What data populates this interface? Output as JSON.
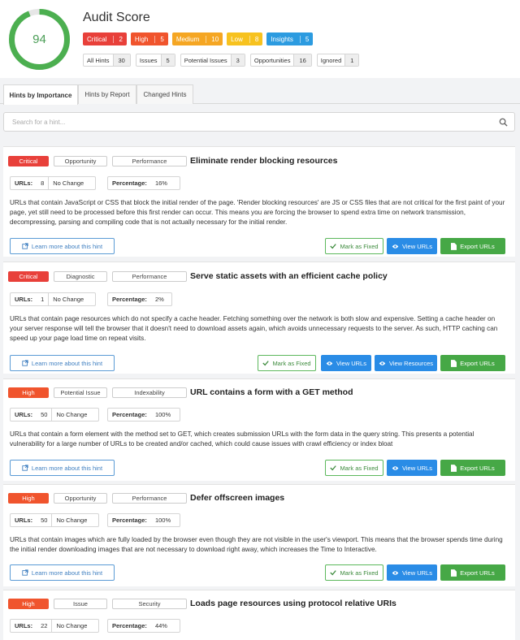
{
  "audit": {
    "title": "Audit Score",
    "score": "94",
    "score_fraction": 0.94,
    "severities": [
      {
        "label": "Critical",
        "count": "2",
        "color": "#e8403a"
      },
      {
        "label": "High",
        "count": "5",
        "color": "#f0542d"
      },
      {
        "label": "Medium",
        "count": "10",
        "color": "#f5a623"
      },
      {
        "label": "Low",
        "count": "8",
        "color": "#f7c21f"
      },
      {
        "label": "Insights",
        "count": "5",
        "color": "#2c9be0"
      }
    ],
    "counts": [
      {
        "label": "All Hints",
        "count": "30"
      },
      {
        "label": "Issues",
        "count": "5"
      },
      {
        "label": "Potential Issues",
        "count": "3"
      },
      {
        "label": "Opportunities",
        "count": "16"
      },
      {
        "label": "Ignored",
        "count": "1"
      }
    ]
  },
  "tabs": [
    "Hints by Importance",
    "Hints by Report",
    "Changed Hints"
  ],
  "search": {
    "placeholder": "Search for a hint..."
  },
  "labels": {
    "urls": "URLs:",
    "percentage": "Percentage:",
    "learn_more": "Learn more about this hint",
    "mark_fixed": "Mark as Fixed",
    "view_urls": "View URLs",
    "view_resources": "View Resources",
    "export_urls": "Export URLs"
  },
  "hints": [
    {
      "severity": "Critical",
      "severity_color": "#e8403a",
      "type": "Opportunity",
      "category": "Performance",
      "title": "Eliminate render blocking resources",
      "urls": "8",
      "change": "No Change",
      "percentage": "16%",
      "desc": "URLs that contain JavaScript or CSS that block the initial render of the page. 'Render blocking resources' are JS or CSS files that are not critical for the first paint of your page, yet still need to be processed before this first render can occur. This means you are forcing the browser to spend extra time on network transmission, decompressing, parsing and compiling code that is not actually necessary for the initial render."
    },
    {
      "severity": "Critical",
      "severity_color": "#e8403a",
      "type": "Diagnostic",
      "category": "Performance",
      "title": "Serve static assets with an efficient cache policy",
      "urls": "1",
      "change": "No Change",
      "percentage": "2%",
      "desc": "URLs that contain page resources which do not specify a cache header. Fetching something over the network is both slow and expensive. Setting a cache header on your server response will tell the browser that it doesn't need to download assets again, which avoids unnecessary requests to the server. As such, HTTP caching can speed up your page load time on repeat visits."
    },
    {
      "severity": "High",
      "severity_color": "#f0542d",
      "type": "Potential Issue",
      "category": "Indexability",
      "title": "URL contains a form with a GET method",
      "urls": "50",
      "change": "No Change",
      "percentage": "100%",
      "desc": "URLs that contain a form element with the method set to GET, which creates submission URLs with the form data in the query string. This presents a potential vulnerability for a large number of URLs to be created and/or cached, which could cause issues with crawl efficiency or index bloat"
    },
    {
      "severity": "High",
      "severity_color": "#f0542d",
      "type": "Opportunity",
      "category": "Performance",
      "title": "Defer offscreen images",
      "urls": "50",
      "change": "No Change",
      "percentage": "100%",
      "desc": "URLs that contain images which are fully loaded by the browser even though they are not visible in the user's viewport. This means that the browser spends time during the initial render downloading images that are not necessary to download right away, which increases the Time to Interactive."
    },
    {
      "severity": "High",
      "severity_color": "#f0542d",
      "type": "Issue",
      "category": "Security",
      "title": "Loads page resources using protocol relative URIs",
      "urls": "22",
      "change": "No Change",
      "percentage": "44%",
      "desc": ""
    }
  ]
}
